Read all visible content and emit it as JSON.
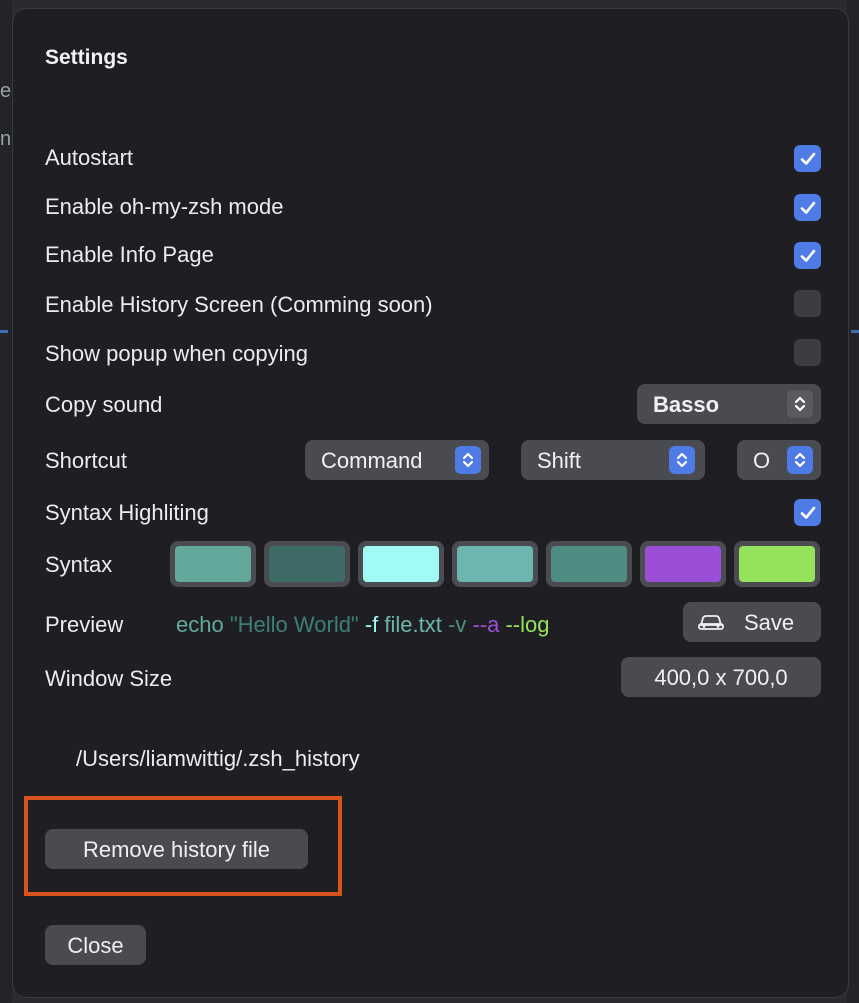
{
  "dialog": {
    "title": "Settings",
    "toggles": [
      {
        "label": "Autostart",
        "checked": true
      },
      {
        "label": "Enable oh-my-zsh mode",
        "checked": true
      },
      {
        "label": "Enable Info Page",
        "checked": true
      },
      {
        "label": "Enable History Screen (Comming soon)",
        "checked": false
      },
      {
        "label": "Show popup when copying",
        "checked": false
      }
    ],
    "copy_sound": {
      "label": "Copy sound",
      "value": "Basso"
    },
    "shortcut": {
      "label": "Shortcut",
      "modifier1": "Command",
      "modifier2": "Shift",
      "key": "O"
    },
    "syntax_highlighting": {
      "label": "Syntax Highliting",
      "checked": true
    },
    "syntax": {
      "label": "Syntax",
      "colors": [
        "#62a89c",
        "#3d6a66",
        "#9ffbf4",
        "#6cb6b0",
        "#4f8c83",
        "#9b4fd6",
        "#94e35a"
      ]
    },
    "preview": {
      "label": "Preview",
      "tokens": [
        {
          "text": "echo ",
          "color": "#62a89c"
        },
        {
          "text": "\"Hello World\" ",
          "color": "#3d7f78"
        },
        {
          "text": "-f ",
          "color": "#9ffbf4"
        },
        {
          "text": "file.txt ",
          "color": "#6cb6b0"
        },
        {
          "text": "-v ",
          "color": "#4f8c83"
        },
        {
          "text": "--a ",
          "color": "#9b4fd6"
        },
        {
          "text": "--log",
          "color": "#94e35a"
        }
      ],
      "save_label": "Save"
    },
    "window_size": {
      "label": "Window Size",
      "value": "400,0 x 700,0"
    },
    "history_path": "/Users/liamwittig/.zsh_history",
    "remove_history_label": "Remove history file",
    "close_label": "Close"
  },
  "colors": {
    "accent": "#4f7be7",
    "highlight": "#d9531e"
  },
  "icons": {
    "checkbox": "checkmark-icon",
    "popup": "chevron-updown-icon",
    "save": "car-icon"
  }
}
